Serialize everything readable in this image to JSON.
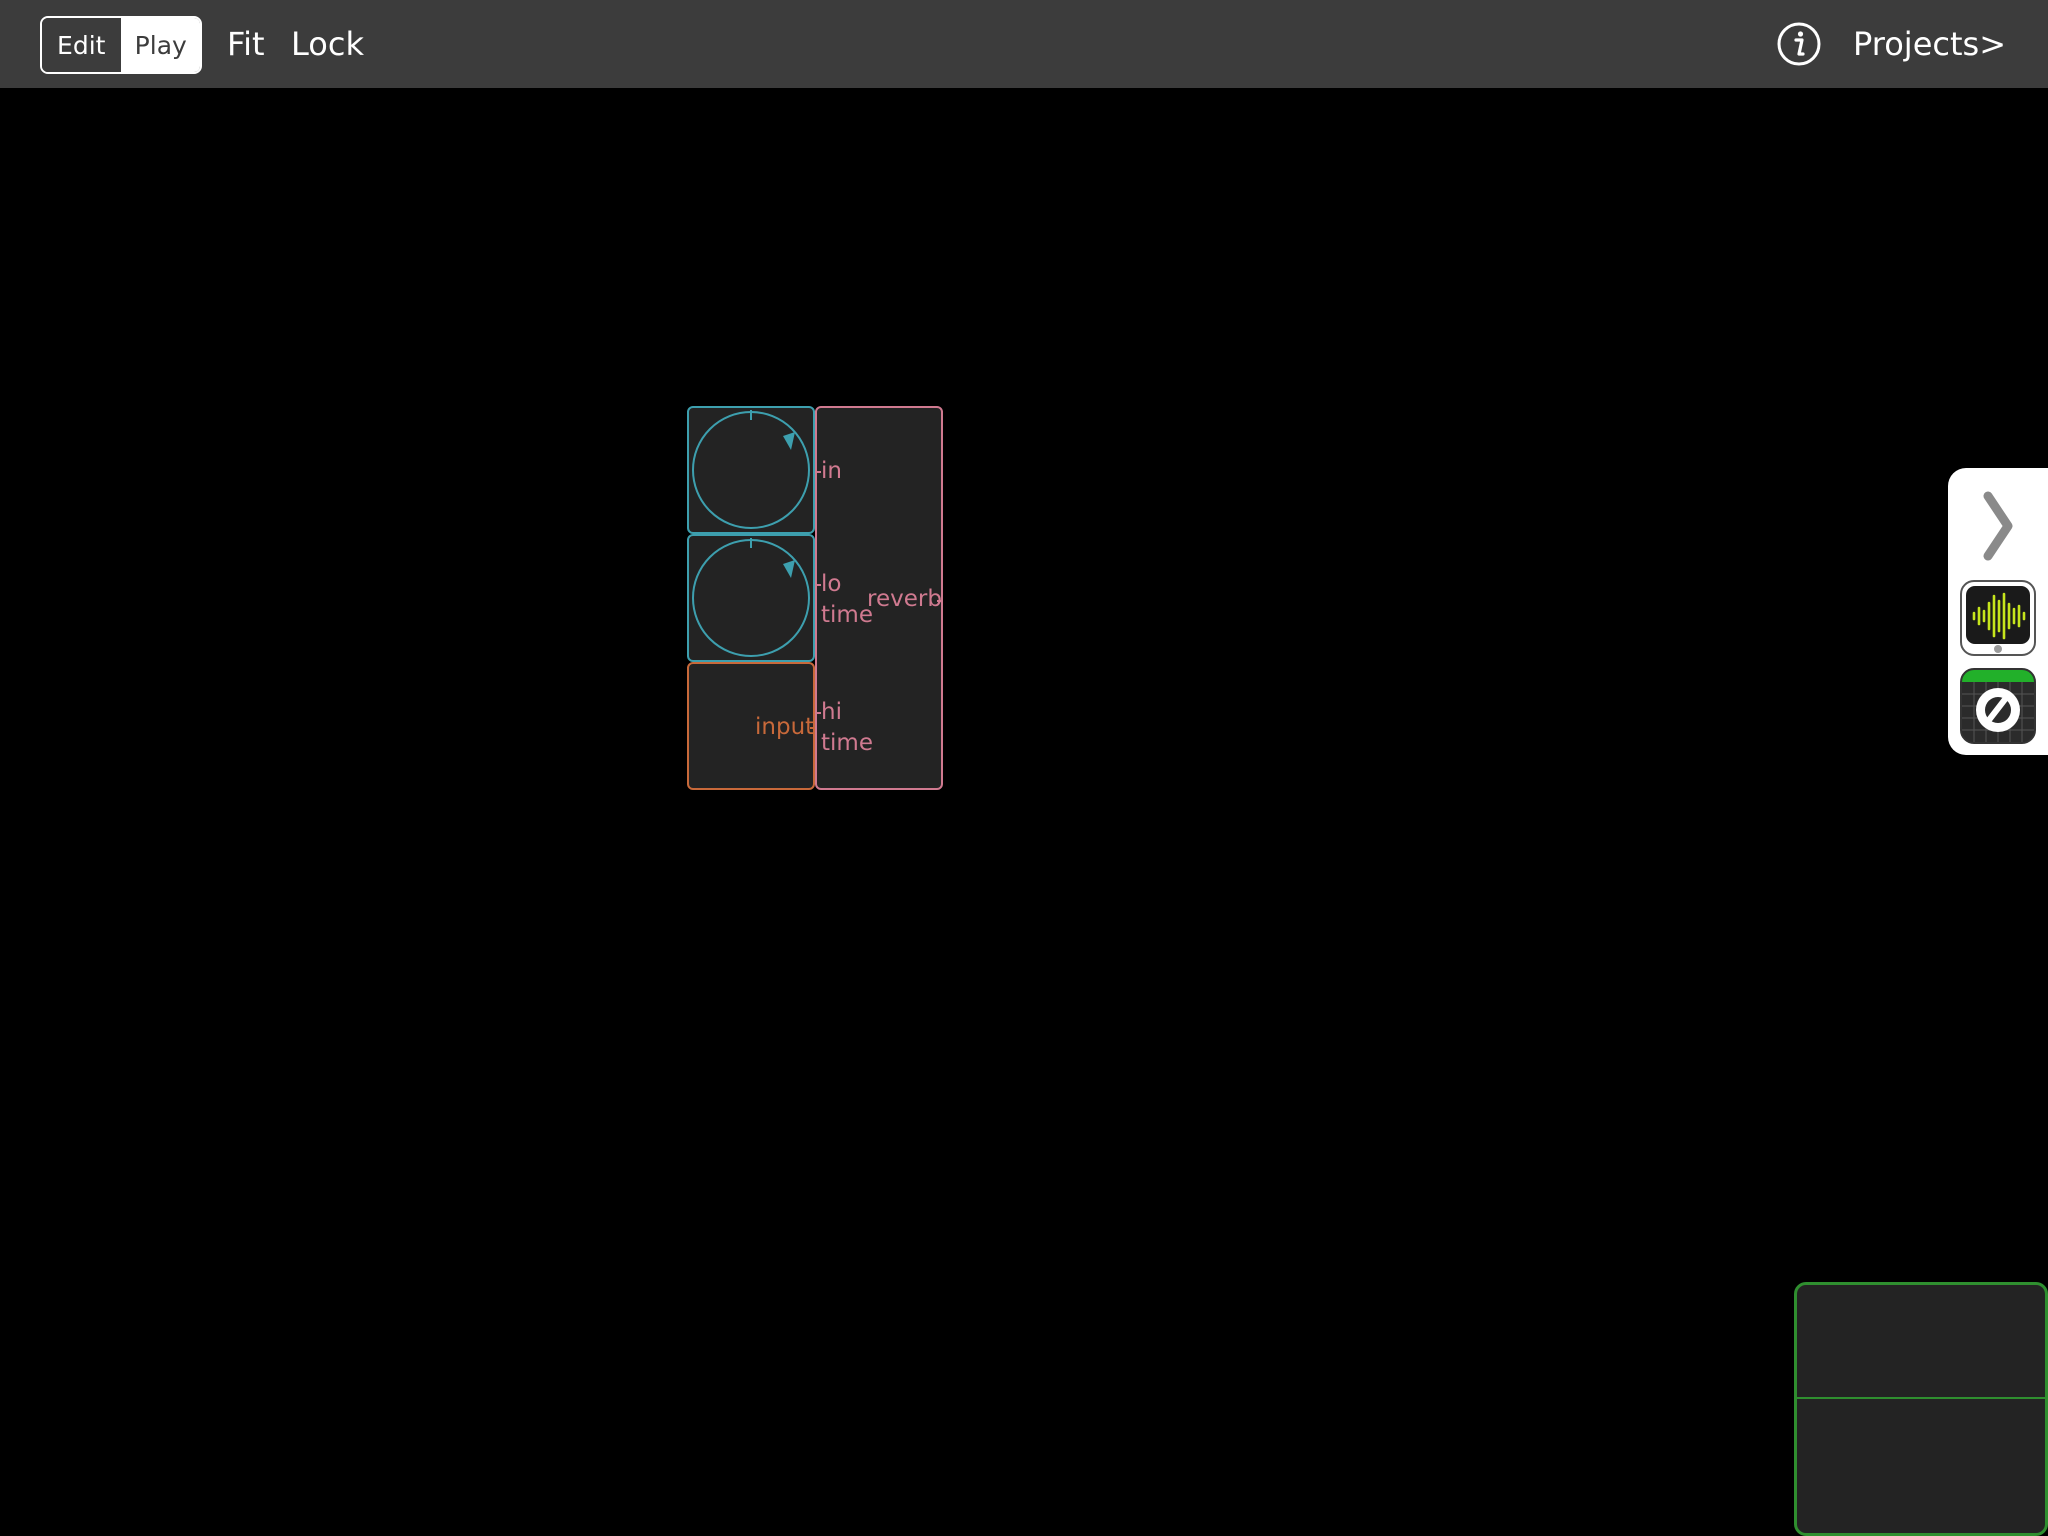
{
  "toolbar": {
    "edit_label": "Edit",
    "play_label": "Play",
    "fit_label": "Fit",
    "lock_label": "Lock",
    "projects_label": "Projects>",
    "info_icon": "info-icon"
  },
  "patch": {
    "knob_color": "#3d9fae",
    "input_color": "#c8693a",
    "reverb_color": "#d07a90",
    "input_module": {
      "label": "input"
    },
    "reverb_module": {
      "label": "reverb",
      "ports": [
        "in",
        "lo\ntime",
        "hi\ntime"
      ]
    }
  },
  "side_panel": {
    "collapse_icon": "chevron-right-icon",
    "apps": [
      "audio-waveform-app-icon",
      "grid-logo-app-icon"
    ]
  },
  "minimap": {
    "accent": "#2f8f2f"
  }
}
